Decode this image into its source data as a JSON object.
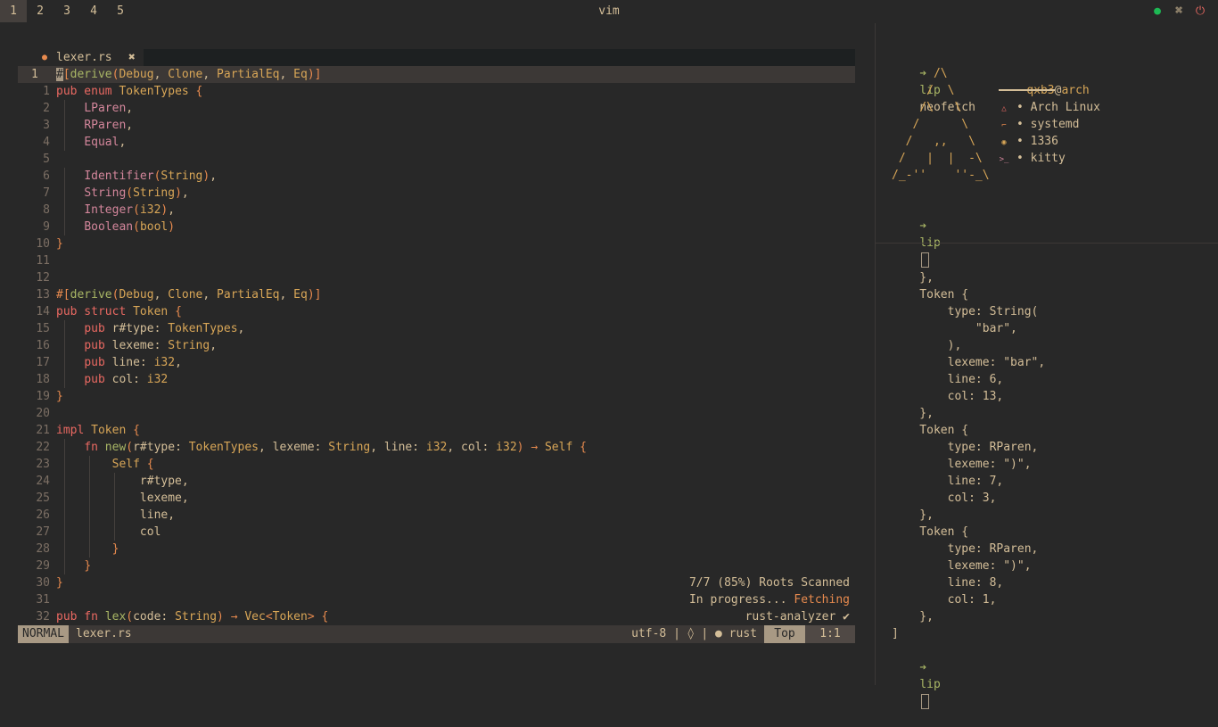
{
  "topbar": {
    "workspaces": [
      "1",
      "2",
      "3",
      "4",
      "5"
    ],
    "active_workspace": 0,
    "title": "vim",
    "tray": [
      {
        "name": "spotify-icon",
        "glyph": "●",
        "color": "#1db954"
      },
      {
        "name": "network-icon",
        "glyph": "⌘",
        "color": "#d4be98"
      },
      {
        "name": "power-icon",
        "glyph": "⏻",
        "color": "#ea6962"
      }
    ]
  },
  "editor": {
    "tab_icon": "●",
    "tab_name": "lexer.rs",
    "tab_close": "✖",
    "lines": [
      {
        "n": "1",
        "cur": true,
        "segs": [
          [
            "cursor",
            "#"
          ],
          [
            "attr",
            "["
          ],
          [
            "fn",
            "derive"
          ],
          [
            "pu",
            "("
          ],
          [
            "ty",
            "Debug"
          ],
          [
            "pl",
            ", "
          ],
          [
            "ty",
            "Clone"
          ],
          [
            "pl",
            ", "
          ],
          [
            "ty",
            "PartialEq"
          ],
          [
            "pl",
            ", "
          ],
          [
            "ty",
            "Eq"
          ],
          [
            "pu",
            ")"
          ],
          [
            "attr",
            "]"
          ]
        ]
      },
      {
        "n": "1",
        "segs": [
          [
            "kw",
            "pub enum "
          ],
          [
            "ty",
            "TokenTypes "
          ],
          [
            "pu",
            "{"
          ]
        ]
      },
      {
        "n": "2",
        "segs": [
          [
            "pl",
            "    "
          ],
          [
            "fld",
            "LParen"
          ],
          [
            "pl",
            ","
          ]
        ]
      },
      {
        "n": "3",
        "segs": [
          [
            "pl",
            "    "
          ],
          [
            "fld",
            "RParen"
          ],
          [
            "pl",
            ","
          ]
        ]
      },
      {
        "n": "4",
        "segs": [
          [
            "pl",
            "    "
          ],
          [
            "fld",
            "Equal"
          ],
          [
            "pl",
            ","
          ]
        ]
      },
      {
        "n": "5",
        "segs": []
      },
      {
        "n": "6",
        "segs": [
          [
            "pl",
            "    "
          ],
          [
            "fld",
            "Identifier"
          ],
          [
            "pu",
            "("
          ],
          [
            "ty",
            "String"
          ],
          [
            "pu",
            ")"
          ],
          [
            "pl",
            ","
          ]
        ]
      },
      {
        "n": "7",
        "segs": [
          [
            "pl",
            "    "
          ],
          [
            "fld",
            "String"
          ],
          [
            "pu",
            "("
          ],
          [
            "ty",
            "String"
          ],
          [
            "pu",
            ")"
          ],
          [
            "pl",
            ","
          ]
        ]
      },
      {
        "n": "8",
        "segs": [
          [
            "pl",
            "    "
          ],
          [
            "fld",
            "Integer"
          ],
          [
            "pu",
            "("
          ],
          [
            "ty",
            "i32"
          ],
          [
            "pu",
            ")"
          ],
          [
            "pl",
            ","
          ]
        ]
      },
      {
        "n": "9",
        "segs": [
          [
            "pl",
            "    "
          ],
          [
            "fld",
            "Boolean"
          ],
          [
            "pu",
            "("
          ],
          [
            "ty",
            "bool"
          ],
          [
            "pu",
            ")"
          ]
        ]
      },
      {
        "n": "10",
        "segs": [
          [
            "pu",
            "}"
          ]
        ]
      },
      {
        "n": "11",
        "segs": []
      },
      {
        "n": "12",
        "segs": []
      },
      {
        "n": "13",
        "segs": [
          [
            "attr",
            "#["
          ],
          [
            "fn",
            "derive"
          ],
          [
            "pu",
            "("
          ],
          [
            "ty",
            "Debug"
          ],
          [
            "pl",
            ", "
          ],
          [
            "ty",
            "Clone"
          ],
          [
            "pl",
            ", "
          ],
          [
            "ty",
            "PartialEq"
          ],
          [
            "pl",
            ", "
          ],
          [
            "ty",
            "Eq"
          ],
          [
            "pu",
            ")"
          ],
          [
            "attr",
            "]"
          ]
        ]
      },
      {
        "n": "14",
        "segs": [
          [
            "kw",
            "pub struct "
          ],
          [
            "ty",
            "Token "
          ],
          [
            "pu",
            "{"
          ]
        ]
      },
      {
        "n": "15",
        "segs": [
          [
            "pl",
            "    "
          ],
          [
            "kw",
            "pub "
          ],
          [
            "pl",
            "r#type: "
          ],
          [
            "ty",
            "TokenTypes"
          ],
          [
            "pl",
            ","
          ]
        ]
      },
      {
        "n": "16",
        "segs": [
          [
            "pl",
            "    "
          ],
          [
            "kw",
            "pub "
          ],
          [
            "pl",
            "lexeme: "
          ],
          [
            "ty",
            "String"
          ],
          [
            "pl",
            ","
          ]
        ]
      },
      {
        "n": "17",
        "segs": [
          [
            "pl",
            "    "
          ],
          [
            "kw",
            "pub "
          ],
          [
            "pl",
            "line: "
          ],
          [
            "ty",
            "i32"
          ],
          [
            "pl",
            ","
          ]
        ]
      },
      {
        "n": "18",
        "segs": [
          [
            "pl",
            "    "
          ],
          [
            "kw",
            "pub "
          ],
          [
            "pl",
            "col: "
          ],
          [
            "ty",
            "i32"
          ]
        ]
      },
      {
        "n": "19",
        "segs": [
          [
            "pu",
            "}"
          ]
        ]
      },
      {
        "n": "20",
        "segs": []
      },
      {
        "n": "21",
        "segs": [
          [
            "kw",
            "impl "
          ],
          [
            "ty",
            "Token "
          ],
          [
            "pu",
            "{"
          ]
        ]
      },
      {
        "n": "22",
        "segs": [
          [
            "pl",
            "    "
          ],
          [
            "kw",
            "fn "
          ],
          [
            "fn",
            "new"
          ],
          [
            "pu",
            "("
          ],
          [
            "pl",
            "r#type: "
          ],
          [
            "ty",
            "TokenTypes"
          ],
          [
            "pl",
            ", lexeme: "
          ],
          [
            "ty",
            "String"
          ],
          [
            "pl",
            ", line: "
          ],
          [
            "ty",
            "i32"
          ],
          [
            "pl",
            ", col: "
          ],
          [
            "ty",
            "i32"
          ],
          [
            "pu",
            ")"
          ],
          [
            "pl",
            " "
          ],
          [
            "pu",
            "→"
          ],
          [
            "pl",
            " "
          ],
          [
            "ty",
            "Self "
          ],
          [
            "pu",
            "{"
          ]
        ]
      },
      {
        "n": "23",
        "segs": [
          [
            "pl",
            "        "
          ],
          [
            "ty",
            "Self "
          ],
          [
            "pu",
            "{"
          ]
        ]
      },
      {
        "n": "24",
        "segs": [
          [
            "pl",
            "            r#type,"
          ]
        ]
      },
      {
        "n": "25",
        "segs": [
          [
            "pl",
            "            lexeme,"
          ]
        ]
      },
      {
        "n": "26",
        "segs": [
          [
            "pl",
            "            line,"
          ]
        ]
      },
      {
        "n": "27",
        "segs": [
          [
            "pl",
            "            col"
          ]
        ]
      },
      {
        "n": "28",
        "segs": [
          [
            "pl",
            "        "
          ],
          [
            "pu",
            "}"
          ]
        ]
      },
      {
        "n": "29",
        "segs": [
          [
            "pl",
            "    "
          ],
          [
            "pu",
            "}"
          ]
        ]
      },
      {
        "n": "30",
        "segs": [
          [
            "pu",
            "}"
          ]
        ]
      },
      {
        "n": "31",
        "segs": []
      },
      {
        "n": "32",
        "segs": [
          [
            "kw",
            "pub fn "
          ],
          [
            "fn",
            "lex"
          ],
          [
            "pu",
            "("
          ],
          [
            "pl",
            "code: "
          ],
          [
            "ty",
            "String"
          ],
          [
            "pu",
            ")"
          ],
          [
            "pl",
            " "
          ],
          [
            "pu",
            "→"
          ],
          [
            "pl",
            " "
          ],
          [
            "ty",
            "Vec"
          ],
          [
            "pu",
            "<"
          ],
          [
            "ty",
            "Token"
          ],
          [
            "pu",
            "> {"
          ]
        ]
      }
    ],
    "lsp": [
      {
        "text": "7/7 (85%) Roots Scanned",
        "color": "#d4be98"
      },
      {
        "text": "In progress... ",
        "accent": "Fetching",
        "color": "#d4be98",
        "accent_color": "#e78a4e"
      },
      {
        "text": "rust-analyzer ✔",
        "color": "#d4be98"
      }
    ],
    "status": {
      "mode": "NORMAL",
      "file": "lexer.rs",
      "right": "utf-8 | ◊ | ● rust",
      "pos": "Top",
      "col": "1:1"
    }
  },
  "term_top": {
    "prompt_user": "lip",
    "command": "neofetch",
    "ascii": [
      "      /\\",
      "     /  \\",
      "    /\\   \\",
      "   /      \\",
      "  /   ,,   \\",
      " /   |  |  -\\",
      "/_-''    ''-_\\"
    ],
    "user": "qxb3",
    "at": "@",
    "host": "arch",
    "info": [
      {
        "icon": "△",
        "color": "#ea6962",
        "text": "• Arch Linux"
      },
      {
        "icon": "⌐",
        "color": "#e78a4e",
        "text": "• systemd"
      },
      {
        "icon": "◉",
        "color": "#d8a657",
        "text": "• 1336"
      },
      {
        "icon": ">_",
        "color": "#d3869b",
        "text": "• kitty"
      }
    ]
  },
  "term_bot": {
    "lines": [
      "    },",
      "    Token {",
      "        type: String(",
      "            \"bar\",",
      "        ),",
      "        lexeme: \"bar\",",
      "        line: 6,",
      "        col: 13,",
      "    },",
      "    Token {",
      "        type: RParen,",
      "        lexeme: \")\",",
      "        line: 7,",
      "        col: 3,",
      "    },",
      "    Token {",
      "        type: RParen,",
      "        lexeme: \")\",",
      "        line: 8,",
      "        col: 1,",
      "    },",
      "]"
    ],
    "prompt_user": "lip"
  }
}
